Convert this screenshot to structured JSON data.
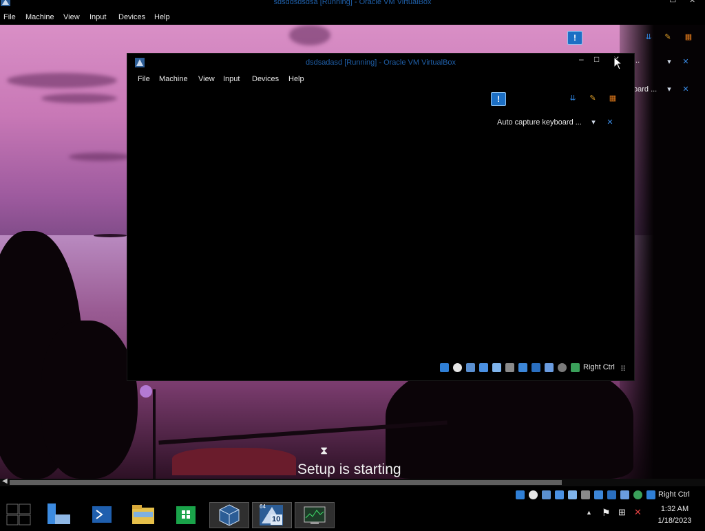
{
  "outer_window": {
    "title": "sdsddsdsdsa [Running] - Oracle VM VirtualBox",
    "menu": [
      "File",
      "Machine",
      "View",
      "Input",
      "Devices",
      "Help"
    ],
    "notice_text": "oard ...",
    "ellipsis": "...",
    "host_key": "Right Ctrl"
  },
  "inner_window": {
    "title": "dsdsadasd [Running] - Oracle VM VirtualBox",
    "menu": [
      "File",
      "Machine",
      "View",
      "Input",
      "Devices",
      "Help"
    ],
    "notice_text": "Auto capture keyboard ...",
    "host_key": "Right Ctrl"
  },
  "setup_text": "Setup is starting",
  "taskbar": {
    "apps": [
      "start",
      "server-manager",
      "powershell",
      "file-explorer",
      "store",
      "virtualbox-manager",
      "vbox-vm-windows10",
      "task-manager"
    ],
    "vm_badge": "10",
    "vm_badge_top": "64",
    "clock_time": "1:32 AM",
    "clock_date": "1/18/2023"
  },
  "colors": {
    "title_blue": "#1f5fa8",
    "notice_blue": "#1c6fc4",
    "taskbar_bg": "#000000"
  }
}
